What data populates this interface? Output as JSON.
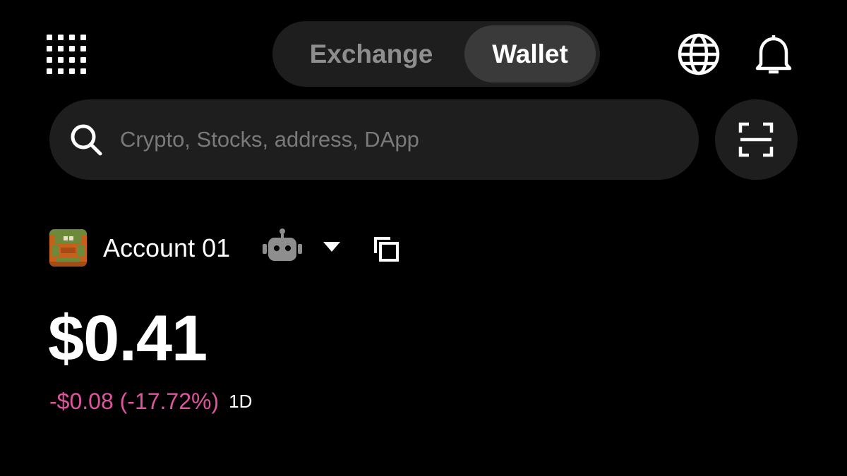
{
  "header": {
    "tabs": [
      {
        "label": "Exchange",
        "active": false
      },
      {
        "label": "Wallet",
        "active": true
      }
    ],
    "icons": {
      "menu": "grid-menu-icon",
      "language": "globe-icon",
      "notifications": "bell-icon"
    }
  },
  "search": {
    "placeholder": "Crypto, Stocks, address, DApp",
    "value": "",
    "scan_icon": "scan-icon"
  },
  "account": {
    "name": "Account 01",
    "avatar_icon": "pixel-avatar",
    "badge_icon": "robot-icon",
    "dropdown_icon": "caret-down-icon",
    "copy_icon": "copy-icon"
  },
  "balance": {
    "total": "$0.41",
    "change": "-$0.08 (-17.72%)",
    "period": "1D"
  },
  "colors": {
    "background": "#000000",
    "surface": "#1e1e1e",
    "active_tab": "#3a3a3a",
    "inactive_text": "#8e8e8e",
    "placeholder": "#7a7a7a",
    "negative": "#e0549e",
    "avatar_orange": "#c8601c",
    "avatar_green": "#6c8a3a"
  }
}
